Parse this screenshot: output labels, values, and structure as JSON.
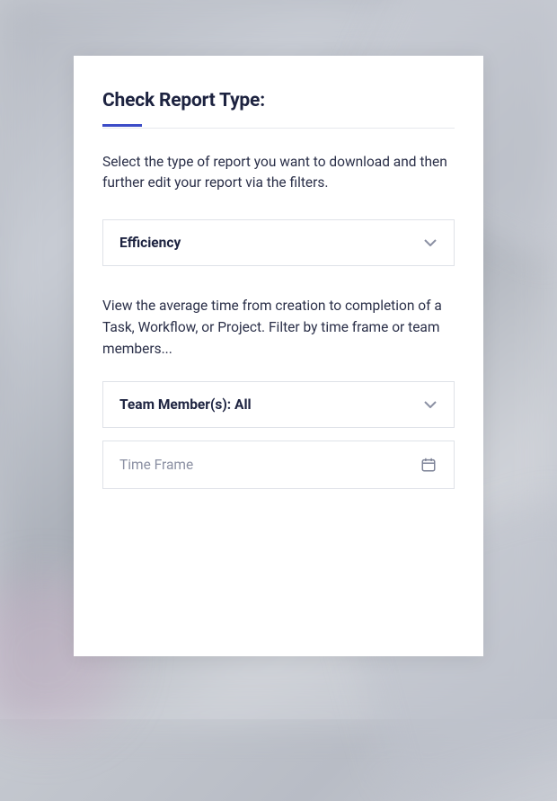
{
  "card": {
    "title": "Check Report Type:",
    "description": "Select the type of report you want to download and then further edit your report via the filters.",
    "reportTypeSelect": {
      "selected": "Efficiency"
    },
    "subDescription": "View the average time from creation to completion of a Task, Workflow, or Project. Filter by time frame or team members...",
    "teamMemberSelect": {
      "selected": "Team Member(s): All"
    },
    "timeFrameInput": {
      "placeholder": "Time Frame"
    }
  }
}
